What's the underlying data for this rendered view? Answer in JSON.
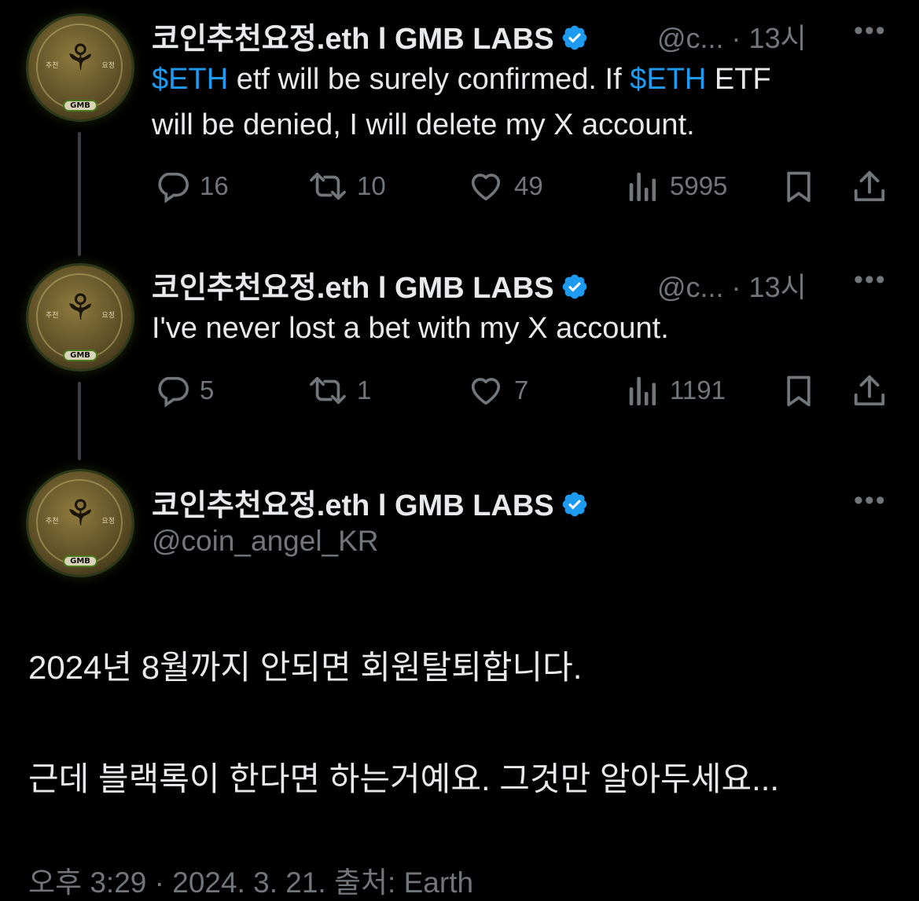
{
  "tweets": [
    {
      "name": "코인추천요정.eth l GMB LABS",
      "handle_time": "@c... · 13시",
      "text_line1_cashtag1": "$ETH",
      "text_line1_mid": " etf will be surely confirmed. If ",
      "text_line1_cashtag2": "$ETH",
      "text_line1_end": " ETF",
      "text_line2": "will be denied, I will delete my X account.",
      "replies": "16",
      "reposts": "10",
      "likes": "49",
      "views": "5995"
    },
    {
      "name": "코인추천요정.eth l GMB LABS",
      "handle_time": "@c... · 13시",
      "text_line1": "I've never lost a bet with my X account.",
      "replies": "5",
      "reposts": "1",
      "likes": "7",
      "views": "1191"
    }
  ],
  "main_tweet": {
    "name": "코인추천요정.eth l GMB LABS",
    "handle": "@coin_angel_KR",
    "text_line1": "2024년 8월까지 안되면 회원탈퇴합니다.",
    "text_line2": "근데 블랙록이 한다면 하는거예요. 그것만 알아두세요...",
    "meta": "오후 3:29 · 2024. 3. 21. 출처: Earth"
  },
  "avatar": {
    "left_text": "추천",
    "right_text": "요정",
    "badge": "GMB"
  },
  "colors": {
    "background": "#000000",
    "text": "#e7e9ea",
    "secondary": "#71767b",
    "accent": "#1d9bf0"
  },
  "icons": {
    "reply": "reply-icon",
    "repost": "repost-icon",
    "like": "heart-icon",
    "views": "views-icon",
    "bookmark": "bookmark-icon",
    "share": "share-icon",
    "more": "more-icon",
    "verified": "verified-badge-icon"
  }
}
